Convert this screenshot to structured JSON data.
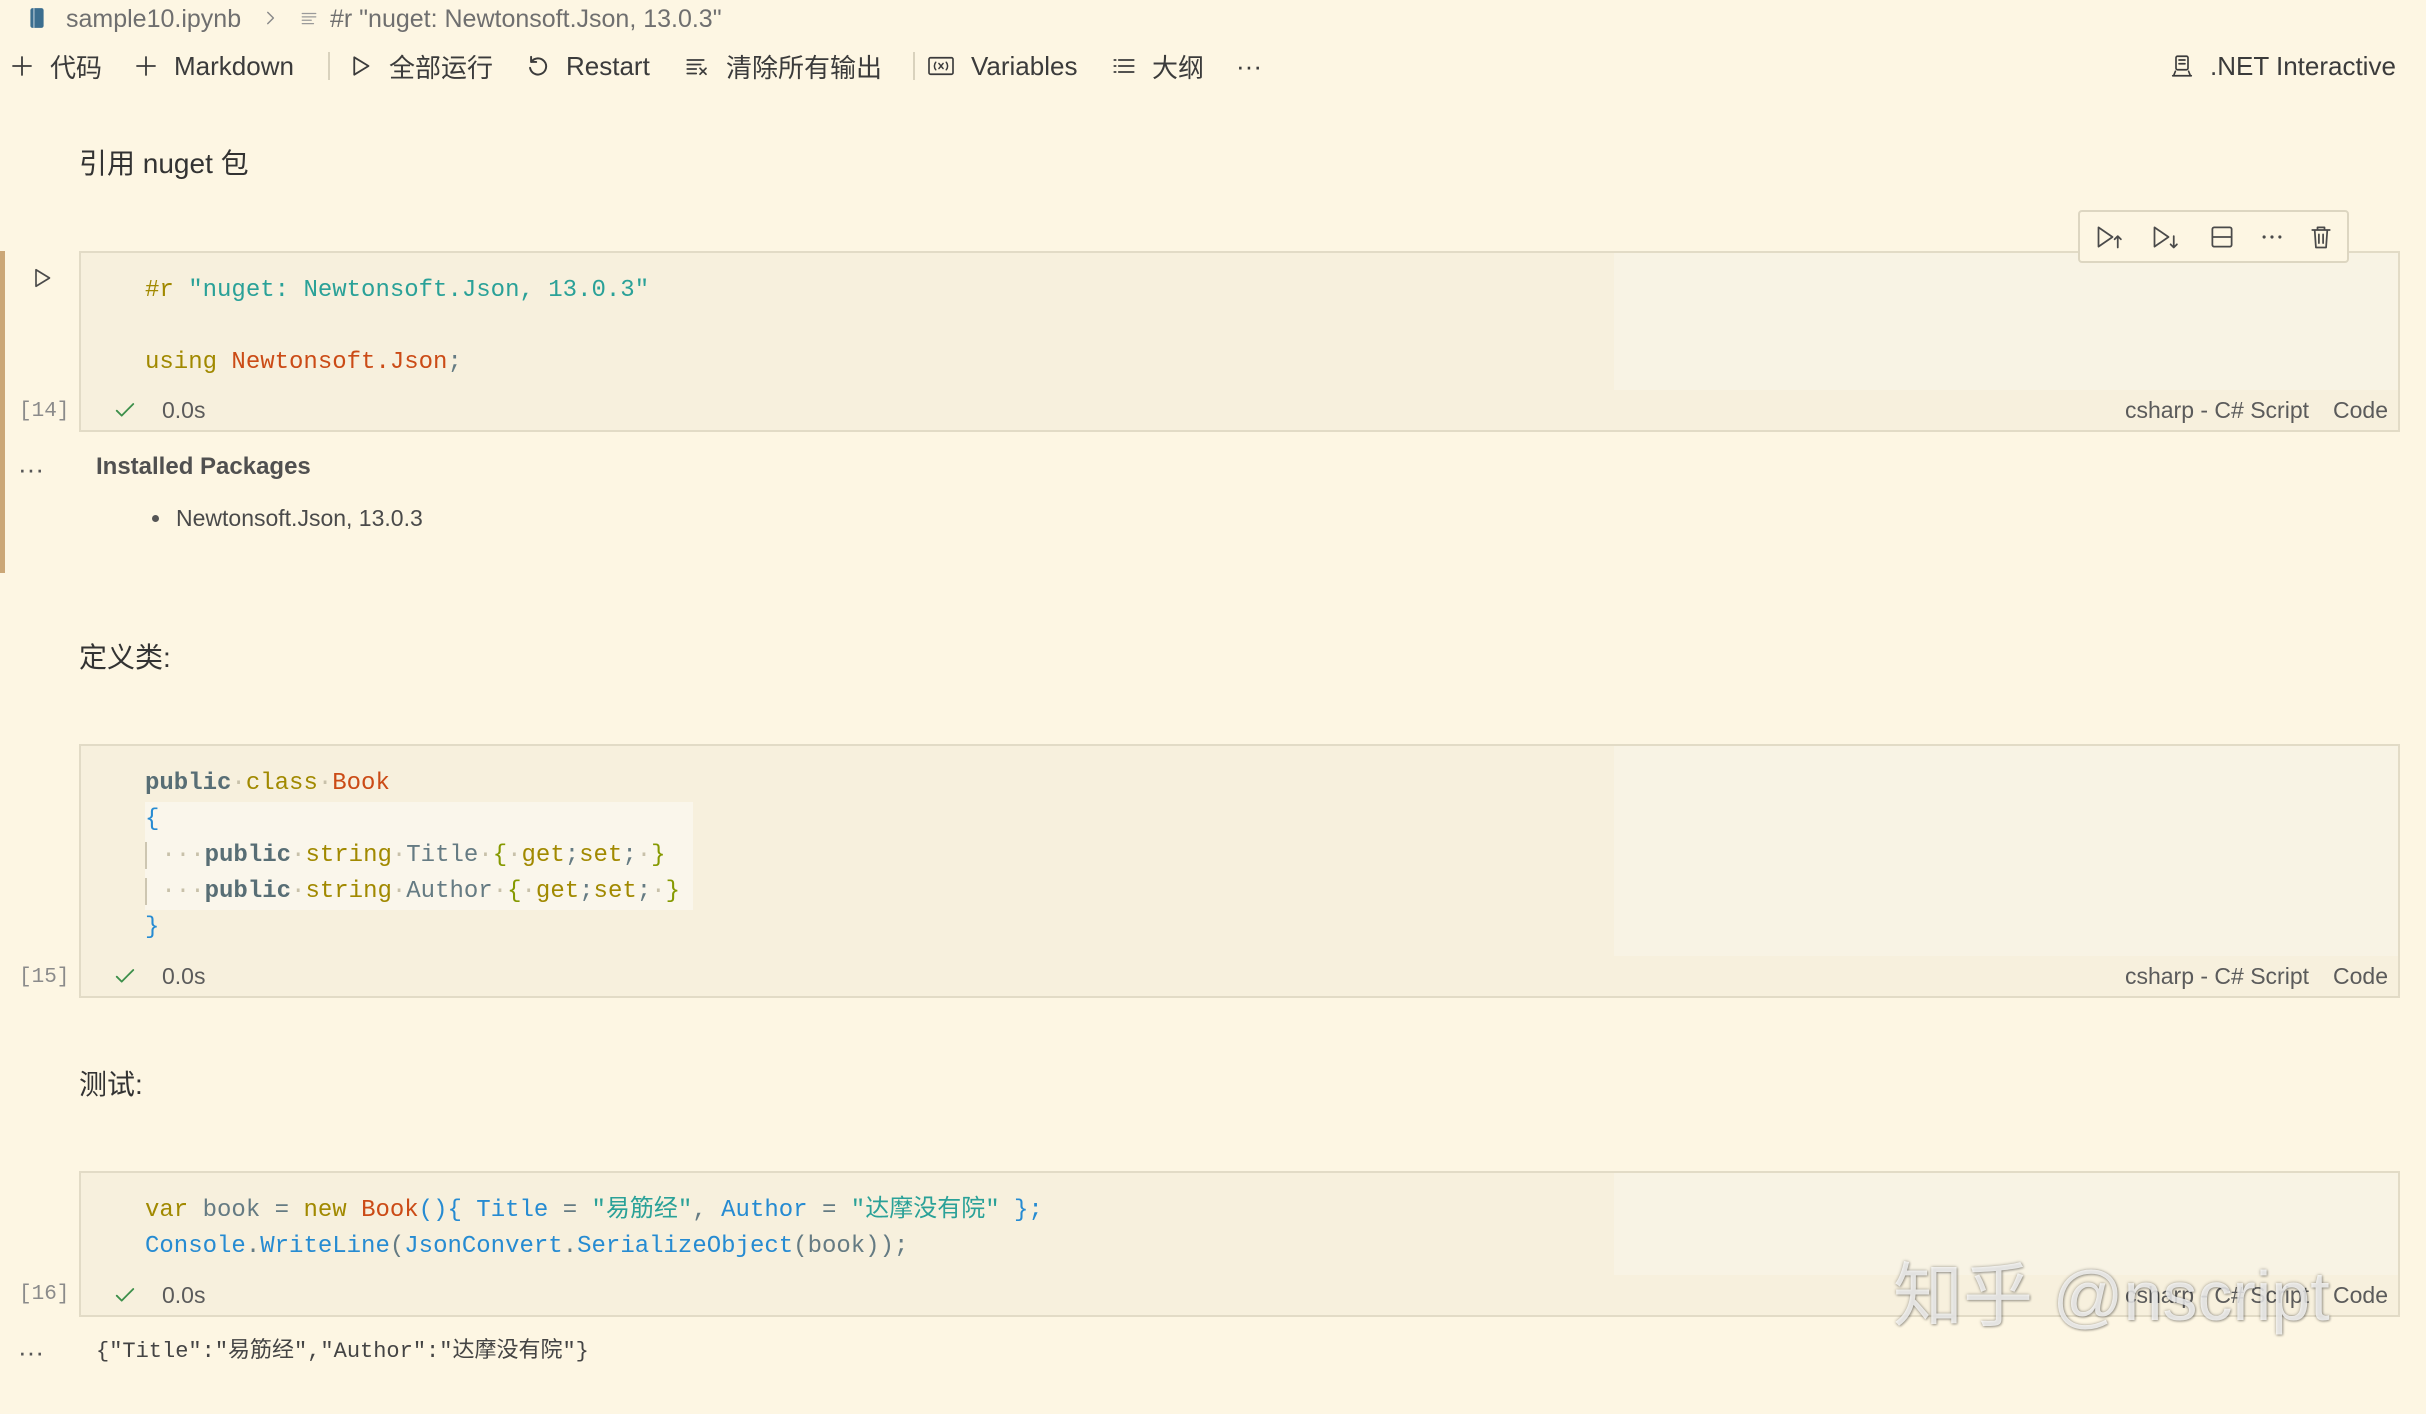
{
  "breadcrumb": {
    "file_name": "sample10.ipynb",
    "cell_label": "#r \"nuget: Newtonsoft.Json, 13.0.3\""
  },
  "toolbar": {
    "add_code_label": "代码",
    "add_markdown_label": "Markdown",
    "run_all_label": "全部运行",
    "restart_label": "Restart",
    "clear_outputs_label": "清除所有输出",
    "variables_label": "Variables",
    "outline_label": "大纲",
    "more_label": "···",
    "kernel_label": ".NET Interactive"
  },
  "markdown_cells": [
    "引用 nuget 包",
    "定义类:",
    "测试:"
  ],
  "code_cells": [
    {
      "exec_count": "[14]",
      "duration": "0.0s",
      "language": "csharp - C# Script",
      "kind": "Code",
      "lines": [
        [
          {
            "t": "#r",
            "c": "#a18900"
          },
          {
            "t": " ",
            "c": "#657b83"
          },
          {
            "t": "\"nuget: Newtonsoft.Json, 13.0.3\"",
            "c": "#2aa198"
          }
        ],
        [],
        [
          {
            "t": "using",
            "c": "#a18900"
          },
          {
            "t": " ",
            "c": "#657b83"
          },
          {
            "t": "Newtonsoft.Json",
            "c": "#cb4b16"
          },
          {
            "t": ";",
            "c": "#657b83"
          }
        ]
      ]
    },
    {
      "exec_count": "[15]",
      "duration": "0.0s",
      "language": "csharp - C# Script",
      "kind": "Code",
      "lines": [
        [
          {
            "t": "public",
            "c": "#586e75",
            "b": true
          },
          {
            "t": "·",
            "c": "#c8c1aa"
          },
          {
            "t": "class",
            "c": "#a18900"
          },
          {
            "t": "·",
            "c": "#c8c1aa"
          },
          {
            "t": "Book",
            "c": "#cb4b16"
          }
        ],
        [
          {
            "t": "{",
            "c": "#268bd2"
          }
        ],
        [
          {
            "t": " ",
            "c": "#c8c1aa",
            "g": true
          },
          {
            "t": "···",
            "c": "#c8c1aa"
          },
          {
            "t": "public",
            "c": "#586e75",
            "b": true
          },
          {
            "t": "·",
            "c": "#c8c1aa"
          },
          {
            "t": "string",
            "c": "#a18900"
          },
          {
            "t": "·",
            "c": "#c8c1aa"
          },
          {
            "t": "Title",
            "c": "#657b83"
          },
          {
            "t": "·",
            "c": "#c8c1aa"
          },
          {
            "t": "{",
            "c": "#859900"
          },
          {
            "t": "·",
            "c": "#c8c1aa"
          },
          {
            "t": "get",
            "c": "#a18900"
          },
          {
            "t": ";",
            "c": "#657b83"
          },
          {
            "t": "set",
            "c": "#a18900"
          },
          {
            "t": ";",
            "c": "#657b83"
          },
          {
            "t": "·",
            "c": "#c8c1aa"
          },
          {
            "t": "}",
            "c": "#859900"
          }
        ],
        [
          {
            "t": " ",
            "c": "#c8c1aa",
            "g": true
          },
          {
            "t": "···",
            "c": "#c8c1aa"
          },
          {
            "t": "public",
            "c": "#586e75",
            "b": true
          },
          {
            "t": "·",
            "c": "#c8c1aa"
          },
          {
            "t": "string",
            "c": "#a18900"
          },
          {
            "t": "·",
            "c": "#c8c1aa"
          },
          {
            "t": "Author",
            "c": "#657b83"
          },
          {
            "t": "·",
            "c": "#c8c1aa"
          },
          {
            "t": "{",
            "c": "#859900"
          },
          {
            "t": "·",
            "c": "#c8c1aa"
          },
          {
            "t": "get",
            "c": "#a18900"
          },
          {
            "t": ";",
            "c": "#657b83"
          },
          {
            "t": "set",
            "c": "#a18900"
          },
          {
            "t": ";",
            "c": "#657b83"
          },
          {
            "t": "·",
            "c": "#c8c1aa"
          },
          {
            "t": "}",
            "c": "#859900"
          }
        ],
        [
          {
            "t": "}",
            "c": "#268bd2"
          }
        ]
      ]
    },
    {
      "exec_count": "[16]",
      "duration": "0.0s",
      "language": "csharp - C# Script",
      "kind": "Code",
      "lines": [
        [
          {
            "t": "var",
            "c": "#a18900"
          },
          {
            "t": " book = ",
            "c": "#657b83"
          },
          {
            "t": "new",
            "c": "#a18900"
          },
          {
            "t": " ",
            "c": "#657b83"
          },
          {
            "t": "Book",
            "c": "#cb4b16"
          },
          {
            "t": "(){",
            "c": "#268bd2"
          },
          {
            "t": " ",
            "c": "#657b83"
          },
          {
            "t": "Title",
            "c": "#268bd2"
          },
          {
            "t": " = ",
            "c": "#657b83"
          },
          {
            "t": "\"易筋经\"",
            "c": "#2aa198"
          },
          {
            "t": ", ",
            "c": "#657b83"
          },
          {
            "t": "Author",
            "c": "#268bd2"
          },
          {
            "t": " = ",
            "c": "#657b83"
          },
          {
            "t": "\"达摩没有院\"",
            "c": "#2aa198"
          },
          {
            "t": " ",
            "c": "#657b83"
          },
          {
            "t": "};",
            "c": "#268bd2"
          }
        ],
        [
          {
            "t": "Console",
            "c": "#268bd2"
          },
          {
            "t": ".",
            "c": "#657b83"
          },
          {
            "t": "WriteLine",
            "c": "#268bd2"
          },
          {
            "t": "(",
            "c": "#657b83"
          },
          {
            "t": "JsonConvert",
            "c": "#268bd2"
          },
          {
            "t": ".",
            "c": "#657b83"
          },
          {
            "t": "SerializeObject",
            "c": "#268bd2"
          },
          {
            "t": "(",
            "c": "#657b83"
          },
          {
            "t": "book",
            "c": "#657b83"
          },
          {
            "t": "));",
            "c": "#657b83"
          }
        ]
      ]
    }
  ],
  "outputs": {
    "more_label": "···",
    "packages_title": "Installed Packages",
    "packages": [
      "Newtonsoft.Json, 13.0.3"
    ],
    "console_text": "{\"Title\":\"易筋经\",\"Author\":\"达摩没有院\"}"
  },
  "watermark": "知乎 @nscript",
  "icons": {
    "breadcrumb": [
      "notebook-file-icon",
      "chevron-right-icon",
      "cell-list-icon"
    ],
    "toolbar": [
      "plus-icon",
      "plus-icon",
      "run-all-icon",
      "restart-icon",
      "clear-all-outputs-icon",
      "variables-icon",
      "outline-icon",
      "kernel-icon"
    ],
    "cell_toolbar": [
      "execute-above-icon",
      "execute-below-icon",
      "split-cell-icon",
      "more-icon",
      "delete-icon"
    ],
    "cell": [
      "run-cell-icon",
      "success-check-icon"
    ]
  },
  "colors": {
    "page_background": "#fdf6e3",
    "cell_background": "#f7f0dd",
    "cell_border": "#e2dbc6",
    "focus_bar": "#cba777",
    "success_check": "#3c8f4a"
  }
}
